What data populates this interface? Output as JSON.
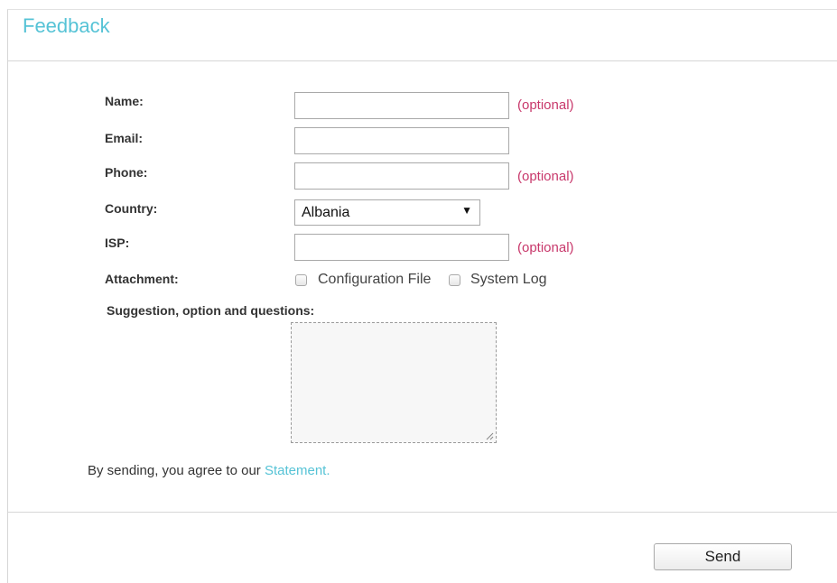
{
  "header": {
    "title": "Feedback"
  },
  "form": {
    "name": {
      "label": "Name:",
      "value": "",
      "hint": "(optional)"
    },
    "email": {
      "label": "Email:",
      "value": ""
    },
    "phone": {
      "label": "Phone:",
      "value": "",
      "hint": "(optional)"
    },
    "country": {
      "label": "Country:",
      "selected": "Albania"
    },
    "isp": {
      "label": "ISP:",
      "value": "",
      "hint": "(optional)"
    },
    "attachment": {
      "label": "Attachment:",
      "options": [
        {
          "label": "Configuration File",
          "checked": false
        },
        {
          "label": "System Log",
          "checked": false
        }
      ]
    },
    "suggestion": {
      "label": "Suggestion, option and questions:",
      "value": ""
    }
  },
  "agreement": {
    "text": "By sending, you agree to our ",
    "link": "Statement."
  },
  "actions": {
    "send_label": "Send"
  },
  "colors": {
    "accent": "#56c3d6",
    "optional": "#c8386b",
    "text": "#333333"
  }
}
